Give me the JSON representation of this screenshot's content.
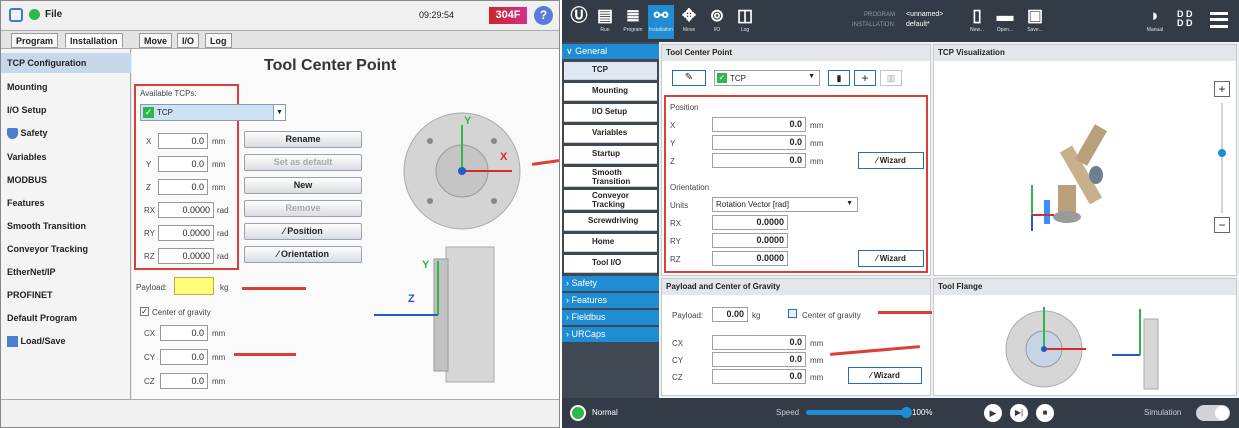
{
  "left": {
    "title": "File",
    "time": "09:29:54",
    "badge": "304F",
    "tabs": [
      "Program",
      "Installation",
      "Move",
      "I/O",
      "Log"
    ],
    "sidebar": [
      "TCP Configuration",
      "Mounting",
      "I/O Setup",
      "Safety",
      "Variables",
      "MODBUS",
      "Features",
      "Smooth Transition",
      "Conveyor Tracking",
      "EtherNet/IP",
      "PROFINET",
      "Default Program",
      "Load/Save"
    ],
    "heading": "Tool Center Point",
    "available_label": "Available TCPs:",
    "tcp_selected": "TCP",
    "pose": [
      {
        "label": "X",
        "value": "0.0",
        "unit": "mm"
      },
      {
        "label": "Y",
        "value": "0.0",
        "unit": "mm"
      },
      {
        "label": "Z",
        "value": "0.0",
        "unit": "mm"
      },
      {
        "label": "RX",
        "value": "0.0000",
        "unit": "rad"
      },
      {
        "label": "RY",
        "value": "0.0000",
        "unit": "rad"
      },
      {
        "label": "RZ",
        "value": "0.0000",
        "unit": "rad"
      }
    ],
    "buttons": {
      "rename": "Rename",
      "default": "Set as default",
      "new": "New",
      "remove": "Remove",
      "position": "Position",
      "orientation": "Orientation"
    },
    "payload_label": "Payload:",
    "payload_unit": "kg",
    "cog_label": "Center of gravity",
    "cog": [
      {
        "label": "CX",
        "value": "0.0",
        "unit": "mm"
      },
      {
        "label": "CY",
        "value": "0.0",
        "unit": "mm"
      },
      {
        "label": "CZ",
        "value": "0.0",
        "unit": "mm"
      }
    ],
    "axis": {
      "x": "X",
      "y": "Y",
      "z": "Z"
    }
  },
  "right": {
    "header_icons": [
      {
        "label": "Run"
      },
      {
        "label": "Program"
      },
      {
        "label": "Installation"
      },
      {
        "label": "Move"
      },
      {
        "label": "I/O"
      },
      {
        "label": "Log"
      }
    ],
    "program_label": "PROGRAM",
    "program_value": "<unnamed>",
    "installation_label": "INSTALLATION",
    "installation_value": "default*",
    "file_buttons": [
      "New...",
      "Open...",
      "Save..."
    ],
    "manual_label": "Manual",
    "sidebar": {
      "general": "General",
      "items": [
        "TCP",
        "Mounting",
        "I/O Setup",
        "Variables",
        "Startup",
        "Smooth Transition",
        "Conveyor Tracking",
        "Screwdriving",
        "Home",
        "Tool I/O"
      ],
      "sections": [
        "Safety",
        "Features",
        "Fieldbus",
        "URCaps"
      ]
    },
    "tcp_pane_title": "Tool Center Point",
    "tcp_name": "TCP",
    "position_label": "Position",
    "position": [
      {
        "label": "X",
        "value": "0.0",
        "unit": "mm"
      },
      {
        "label": "Y",
        "value": "0.0",
        "unit": "mm"
      },
      {
        "label": "Z",
        "value": "0.0",
        "unit": "mm"
      }
    ],
    "wizard": "Wizard",
    "orientation_label": "Orientation",
    "units_label": "Units",
    "units_value": "Rotation Vector [rad]",
    "orientation": [
      {
        "label": "RX",
        "value": "0.0000"
      },
      {
        "label": "RY",
        "value": "0.0000"
      },
      {
        "label": "RZ",
        "value": "0.0000"
      }
    ],
    "viz_title": "TCP Visualization",
    "payload_title": "Payload and Center of Gravity",
    "payload_label": "Payload:",
    "payload_value": "0.00",
    "payload_unit": "kg",
    "cog_label": "Center of gravity",
    "cog": [
      {
        "label": "CX",
        "value": "0.0",
        "unit": "mm"
      },
      {
        "label": "CY",
        "value": "0.0",
        "unit": "mm"
      },
      {
        "label": "CZ",
        "value": "0.0",
        "unit": "mm"
      }
    ],
    "flange_title": "Tool Flange",
    "status": "Normal",
    "speed_label": "Speed",
    "speed_value": "100%",
    "speed_fraction": 1.0,
    "simulation_label": "Simulation"
  },
  "colors": {
    "accent_blue": "#1f8cd3",
    "highlight_red": "#d9403a",
    "status_green": "#2fb84a",
    "header_dark": "#333b46"
  }
}
